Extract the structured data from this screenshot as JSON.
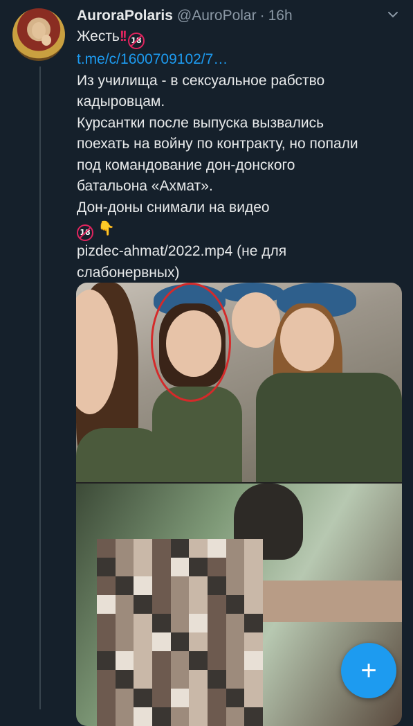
{
  "tweet": {
    "author_name": "AuroraPolaris",
    "author_handle": "@AuroPolar",
    "separator": "·",
    "time": "16h",
    "first_line_text": "Жесть",
    "link_text": "t.me/c/1600709102/7…",
    "body_lines": [
      "Из училища - в сексуальное рабство",
      "кадыровцам.",
      "Курсантки после выпуска вызвались",
      "поехать на войну по контракту, но попали",
      "под командование дон-донского",
      "батальона «Ахмат».",
      "Дон-доны снимали на видео"
    ],
    "file_line_1": "pizdec-ahmat/2022.mp4 (не для",
    "file_line_2": "слабонервных)",
    "emoji_18_label": "18"
  },
  "icons": {
    "more": "chevron-down-icon",
    "compose": "plus-icon",
    "adult": "no-under-18-icon",
    "double-exclamation": "double-exclamation-icon",
    "point-down": "backhand-index-pointing-down-icon"
  },
  "fab": {
    "label": "+"
  },
  "colors": {
    "background": "#15202b",
    "text": "#e7e9ea",
    "muted": "#8b98a5",
    "link": "#1d9bf0",
    "accent": "#1d9bf0",
    "alert": "#e0245e"
  }
}
